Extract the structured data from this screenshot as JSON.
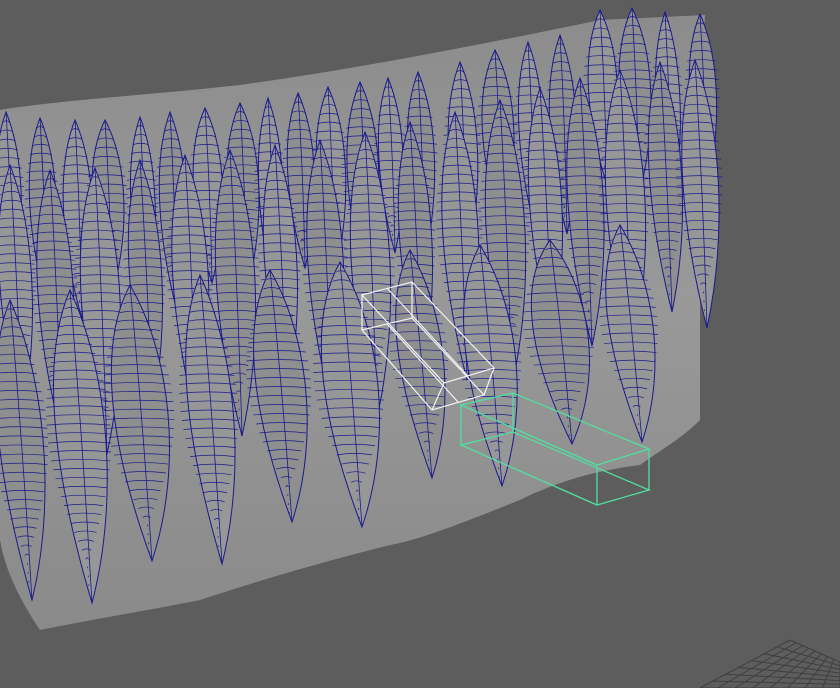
{
  "viewport": {
    "background_color": "#5d5d5d",
    "wireframe_color": "#1a1a8c",
    "surface_color": "#8f8f8f",
    "selection_white_color": "#f2f2f2",
    "selection_green_color": "#4fe0a0",
    "ground_grid_color": "#3f3f3f"
  },
  "scene": {
    "object": "feather-wing-mesh",
    "selected_objects": [
      "white-lattice-box",
      "green-lattice-box"
    ],
    "ground_grid_visible": true
  }
}
